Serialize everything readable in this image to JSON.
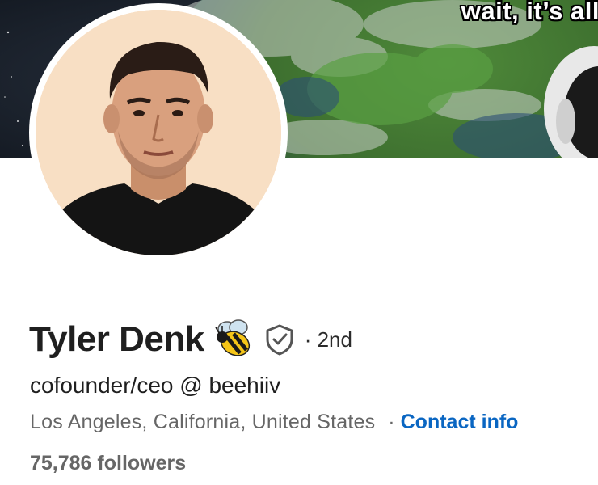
{
  "banner": {
    "caption": "wait, it’s all",
    "background_icon": "earth-from-space-meme",
    "astronaut_icon": "astronaut-icon"
  },
  "profile": {
    "avatar_icon": "profile-photo",
    "name": "Tyler Denk",
    "name_emoji": "bee-icon",
    "verified_icon": "shield-check-icon",
    "connection_degree": "· 2nd",
    "headline": "cofounder/ceo @ beehiiv",
    "location": "Los Angeles, California, United States",
    "separator": "·",
    "contact_label": "Contact info",
    "followers": "75,786 followers"
  },
  "colors": {
    "link": "#0a66c2",
    "text_primary": "#1f1f1f",
    "text_secondary": "#666666"
  }
}
